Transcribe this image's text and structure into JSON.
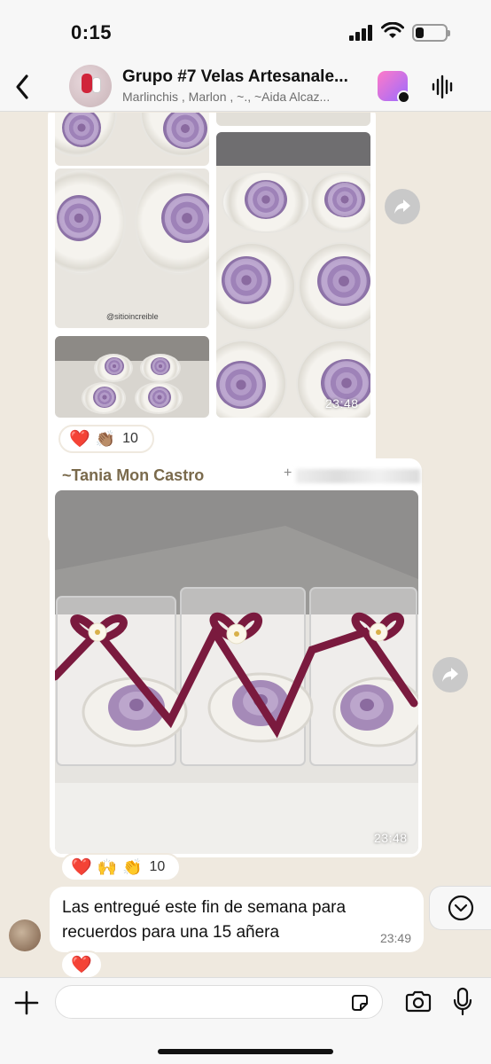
{
  "status_bar": {
    "time": "0:15",
    "battery_level": 0.25
  },
  "header": {
    "title": "Grupo #7 Velas Artesanale...",
    "subtitle": "Marlinchis , Marlon , ~., ~Aida Alcaz...",
    "back_icon": "chevron-left-icon",
    "ai_icon": "meta-ai-icon",
    "voice_icon": "audio-wave-icon"
  },
  "messages": [
    {
      "type": "image-album",
      "watermark": "@sitioincreible",
      "time": "23:48",
      "reactions": {
        "emojis": [
          "❤️",
          "👏🏽"
        ],
        "count": "10"
      }
    },
    {
      "type": "image",
      "sender": "~Tania Mon Castro",
      "phone_prefix": "+",
      "time": "23:48",
      "reactions": {
        "emojis": [
          "❤️",
          "🙌",
          "👏"
        ],
        "count": "10"
      }
    },
    {
      "type": "text",
      "text": "Las entregué este fin de semana para recuerdos para una 15 añera",
      "time": "23:49",
      "reactions": {
        "emojis": [
          "❤️"
        ]
      }
    }
  ],
  "input_bar": {
    "placeholder": "",
    "plus_icon": "plus-icon",
    "sticker_icon": "sticker-icon",
    "camera_icon": "camera-icon",
    "mic_icon": "microphone-icon"
  },
  "colors": {
    "sender_name": "#7a6a4c",
    "chat_bg": "#efe9df",
    "heart": "#e0202e",
    "ribbon": "#7a1a3e"
  }
}
